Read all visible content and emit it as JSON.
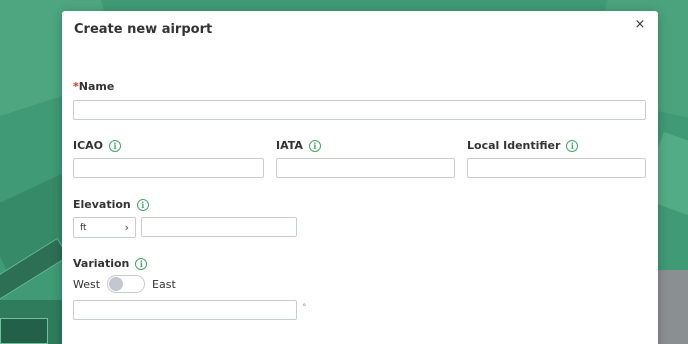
{
  "dialog": {
    "title": "Create new airport",
    "close_glyph": "×"
  },
  "fields": {
    "name": {
      "required_mark": "*",
      "label": "Name",
      "value": ""
    },
    "icao": {
      "label": "ICAO",
      "value": ""
    },
    "iata": {
      "label": "IATA",
      "value": ""
    },
    "local_identifier": {
      "label": "Local Identifier",
      "value": ""
    },
    "elevation": {
      "label": "Elevation",
      "unit": "ft",
      "value": ""
    },
    "variation": {
      "label": "Variation",
      "west_label": "West",
      "east_label": "East",
      "toggle_on": false,
      "value": "",
      "unit_symbol": "°"
    }
  },
  "icons": {
    "info": "info-icon",
    "close": "close-icon",
    "chevron": "chevron-right-icon"
  },
  "colors": {
    "accent_green": "#43a56b",
    "required_red": "#d0341e",
    "map_background": "#3f9a75"
  }
}
